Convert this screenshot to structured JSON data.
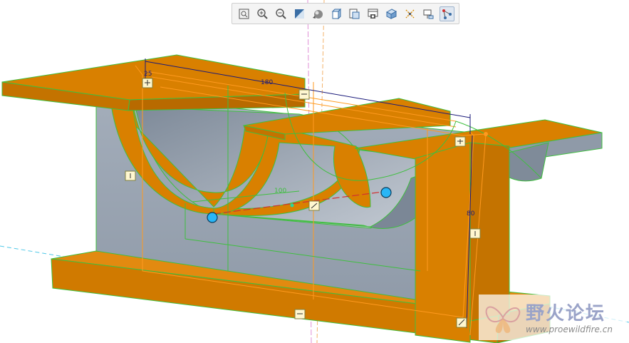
{
  "toolbar": {
    "buttons": [
      {
        "icon": "refit-icon",
        "active": false
      },
      {
        "icon": "zoom-in-icon",
        "active": false
      },
      {
        "icon": "zoom-out-icon",
        "active": false
      },
      {
        "icon": "repaint-icon",
        "active": false
      },
      {
        "icon": "display-style-icon",
        "active": false
      },
      {
        "icon": "saved-orientations-icon",
        "active": false
      },
      {
        "icon": "view-manager-icon",
        "active": false
      },
      {
        "icon": "perspective-view-icon",
        "active": false
      },
      {
        "icon": "section-view-icon",
        "active": false
      },
      {
        "icon": "datum-display-icon",
        "active": false
      },
      {
        "icon": "annotation-display-icon",
        "active": false
      },
      {
        "icon": "sketch-display-icon",
        "active": true
      }
    ]
  },
  "dimensions": {
    "width_label": "180",
    "depth_label": "100",
    "height_label": "80",
    "small_label": "25"
  },
  "watermark": {
    "title": "野火论坛",
    "url": "www.proewildfire.cn"
  },
  "colors": {
    "face_orange": "#d98000",
    "body_gray": "#9aa5b3",
    "edge_green": "#3fbf3f",
    "sketch_orange": "#ff9a1f",
    "dim_navy": "#1a1a7a",
    "handle_cyan": "#29b6f6"
  }
}
